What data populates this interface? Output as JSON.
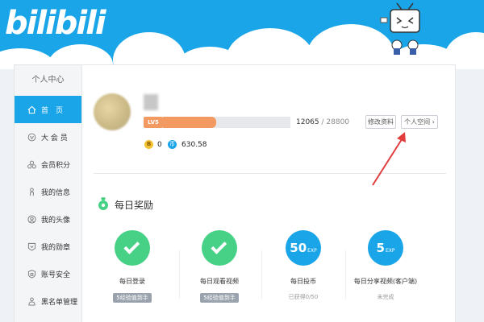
{
  "brand": {
    "logo_text": "bilibili"
  },
  "sidebar": {
    "title": "个人中心",
    "items": [
      {
        "label": "首　页",
        "icon": "home-icon",
        "active": true
      },
      {
        "label": "大 会 员",
        "icon": "vip-icon"
      },
      {
        "label": "会员积分",
        "icon": "points-icon"
      },
      {
        "label": "我的信息",
        "icon": "info-icon"
      },
      {
        "label": "我的头像",
        "icon": "avatar-icon"
      },
      {
        "label": "我的勋章",
        "icon": "medal-icon"
      },
      {
        "label": "账号安全",
        "icon": "shield-icon"
      },
      {
        "label": "黑名单管理",
        "icon": "blacklist-icon"
      }
    ]
  },
  "profile": {
    "level": "LV5",
    "exp_current": "12065",
    "exp_sep": " / ",
    "exp_total": "28800",
    "exp_progress": 0.419,
    "b_coin_icon": "B",
    "b_coins": "0",
    "coin_icon": "币",
    "coins": "630.58",
    "edit_label": "修改资料",
    "space_label": "个人空间 ›"
  },
  "daily": {
    "title": "每日奖励",
    "tasks": [
      {
        "label": "每日登录",
        "state": "done",
        "badge": "5经验值到手"
      },
      {
        "label": "每日观看视频",
        "state": "done",
        "badge": "5经验值到手"
      },
      {
        "label": "每日投币",
        "state": "todo",
        "exp": "50",
        "unit": "EXP",
        "status": "已获得0/50"
      },
      {
        "label": "每日分享视频(客户端)",
        "state": "todo",
        "exp": "5",
        "unit": "EXP",
        "status": "未完成"
      }
    ]
  },
  "colors": {
    "brand_blue": "#1aa5e8",
    "level_orange": "#f29a61",
    "done_green": "#47d187",
    "annotation_red": "#e23d3d"
  }
}
